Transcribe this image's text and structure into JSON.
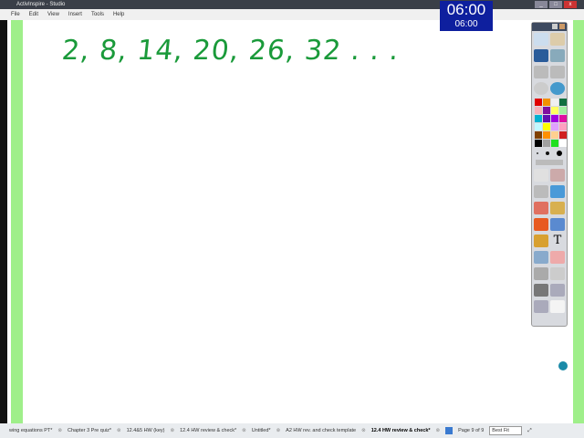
{
  "window": {
    "title": "ActivInspire - Studio"
  },
  "menu": [
    "File",
    "Edit",
    "View",
    "Insert",
    "Tools",
    "Help"
  ],
  "canvas": {
    "handwriting": "2, 8, 14, 20, 26, 32 . . ."
  },
  "timer": {
    "display": "06:00",
    "preset": "06:00"
  },
  "toolbox": {
    "palette": [
      "#e00000",
      "#f39000",
      "#f0f0f0",
      "#107040",
      "#f7b0b8",
      "#8010a0",
      "#ffff60",
      "#a0f0a0",
      "#00b0d0",
      "#6010b0",
      "#a000e0",
      "#e010a0",
      "#c0f8ff",
      "#ffff00",
      "#e0a0ff",
      "#ffa0c0",
      "#804000",
      "#ff9000",
      "#ffd090",
      "#d02020",
      "#000000",
      "#a0a0a0",
      "#20e020",
      "#ffffff"
    ]
  },
  "tabs": [
    {
      "label": "wing equations PT*"
    },
    {
      "label": "Chapter 3 Pre quiz*"
    },
    {
      "label": "12.4&5 HW (key)"
    },
    {
      "label": "12.4 HW review & check*"
    },
    {
      "label": "Untitled*"
    },
    {
      "label": "A2 HW rev. and check template"
    },
    {
      "label": "12.4 HW review & check*",
      "active": true
    }
  ],
  "status": {
    "page": "Page 9 of 9",
    "zoom": "Best Fit"
  }
}
